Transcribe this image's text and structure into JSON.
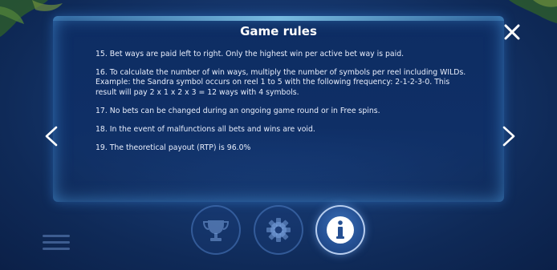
{
  "title": "Game rules",
  "rules": [
    "15. Bet ways are paid left to right. Only the highest win per active bet way is paid.",
    "16. To calculate the number of win ways, multiply the number of symbols per reel including WILDs. Example: the Sandra symbol occurs on reel 1 to 5 with the following frequency:  2-1-2-3-0. This result will pay 2 x 1 x 2 x 3 = 12 ways with 4 symbols.",
    "17. No bets can be changed during an ongoing game round or in Free spins.",
    "18. In the event of malfunctions all bets and wins are void.",
    "19. The theoretical payout (RTP) is 96.0%"
  ],
  "icons": {
    "close": "close-icon",
    "prev": "chevron-left-icon",
    "next": "chevron-right-icon",
    "menu": "hamburger-menu-icon",
    "trophy": "trophy-icon",
    "settings": "gear-icon",
    "info": "info-icon"
  },
  "colors": {
    "background": "#173a72",
    "panel": "#0f2f66",
    "panel_glow": "#5ab4ff",
    "text": "#e8eefc",
    "active_button": "#2a5aa0"
  },
  "active_tab": "info"
}
